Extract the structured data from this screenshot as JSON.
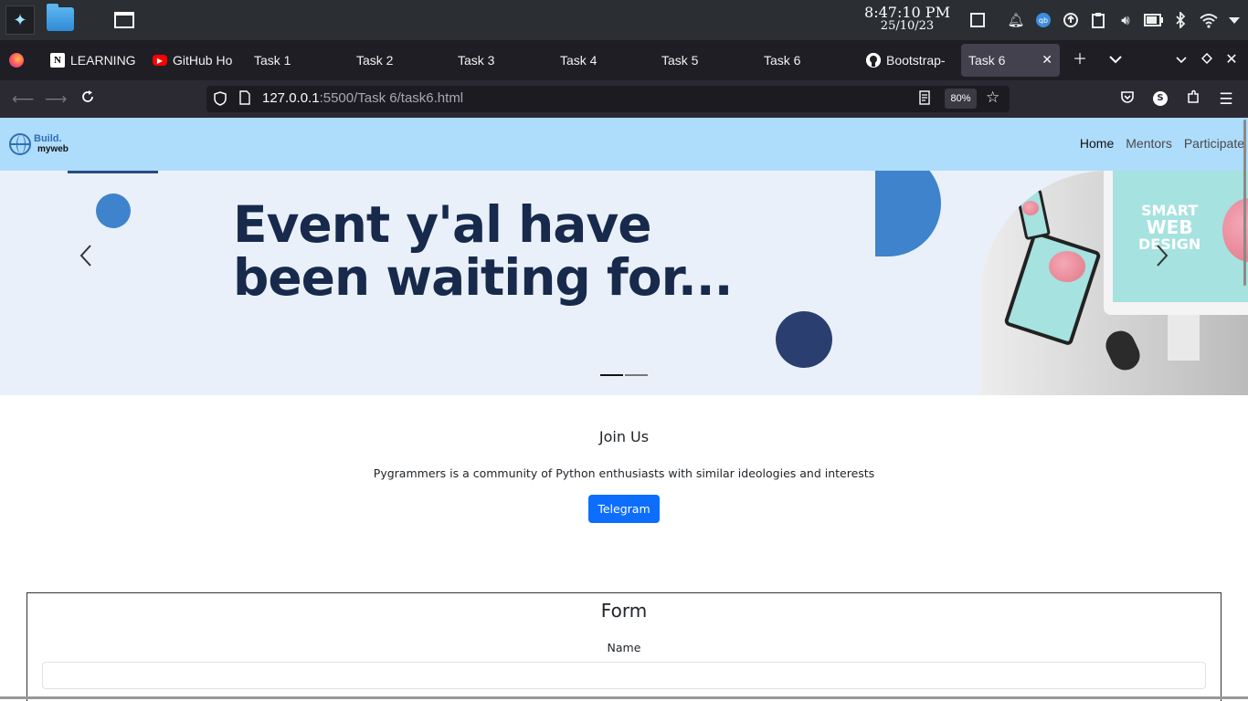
{
  "os": {
    "time": "8:47:10 PM",
    "date": "25/10/23"
  },
  "browser": {
    "tabs": [
      {
        "label": "LEARNING",
        "icon": "notion-icon"
      },
      {
        "label": "GitHub Ho",
        "icon": "youtube-icon"
      },
      {
        "label": "Task 1"
      },
      {
        "label": "Task 2"
      },
      {
        "label": "Task 3"
      },
      {
        "label": "Task 4"
      },
      {
        "label": "Task 5"
      },
      {
        "label": "Task 6"
      },
      {
        "label": "Bootstrap-",
        "icon": "github-icon"
      },
      {
        "label": "Task 6",
        "active": true
      }
    ],
    "url_host": "127.0.0.1",
    "url_path": ":5500/Task 6/task6.html",
    "zoom": "80%",
    "profile_initial": "S"
  },
  "site": {
    "brand_line1": "Build.",
    "brand_line2": "myweb",
    "nav": [
      "Home",
      "Mentors",
      "Participate"
    ],
    "carousel": {
      "headline_line1": "Event y'al have",
      "headline_line2": "been waiting for...",
      "image_text_line1": "SMART",
      "image_text_line2": "WEB",
      "image_text_line3": "DESIGN",
      "slide_count": 2,
      "active_slide": 1
    },
    "join": {
      "title": "Join Us",
      "description": "Pygrammers is a community of Python enthusiasts with similar ideologies and interests",
      "button": "Telegram"
    },
    "form": {
      "title": "Form",
      "name_label": "Name"
    }
  },
  "colors": {
    "navbar_bg": "#aedcfb",
    "carousel_bg": "#e9f0f9",
    "headline": "#172a4c",
    "accent_blue": "#3e83cc",
    "dark_navy": "#2a3f6f",
    "button_primary": "#0d6efd"
  }
}
